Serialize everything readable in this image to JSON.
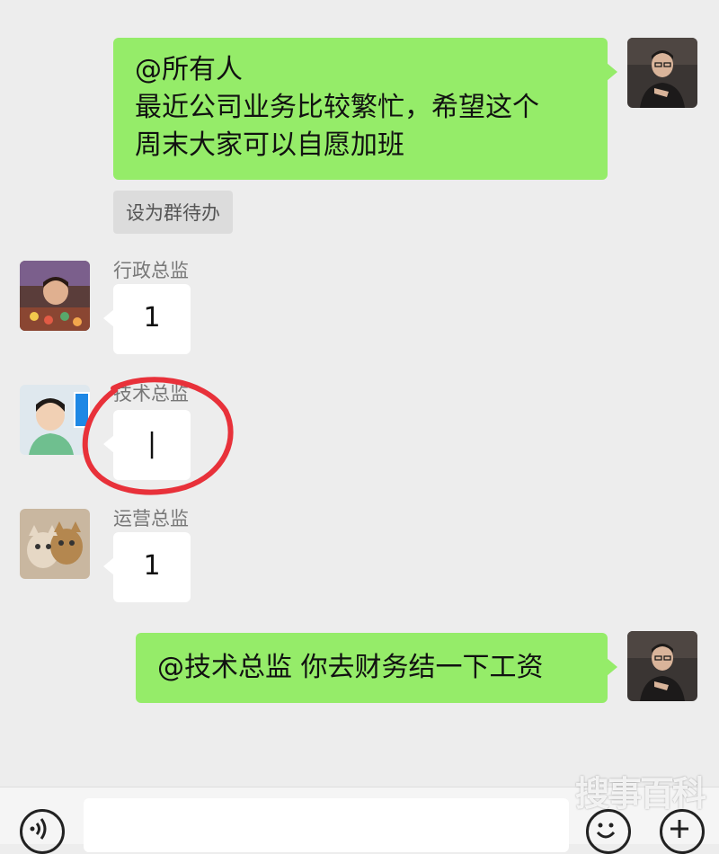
{
  "chat": {
    "messages": [
      {
        "sender": "",
        "text": "@所有人\n最近公司业务比较繁忙，希望这个\n周末大家可以自愿加班",
        "side": "right"
      },
      {
        "sender": "行政总监",
        "text": "1",
        "side": "left"
      },
      {
        "sender": "技术总监",
        "text": "|",
        "side": "left"
      },
      {
        "sender": "运营总监",
        "text": "1",
        "side": "left"
      },
      {
        "sender": "",
        "text": "@技术总监 你去财务结一下工资",
        "side": "right"
      }
    ],
    "todo_chip": "设为群待办",
    "highlight_color": "#e8313a"
  },
  "input_bar": {
    "voice_icon": "voice-icon",
    "emoji_icon": "emoji-icon",
    "plus_icon": "plus-icon"
  },
  "watermark": "搜事百科",
  "colors": {
    "bubble_green": "#95ec69",
    "bubble_white": "#ffffff",
    "background": "#ededed"
  }
}
